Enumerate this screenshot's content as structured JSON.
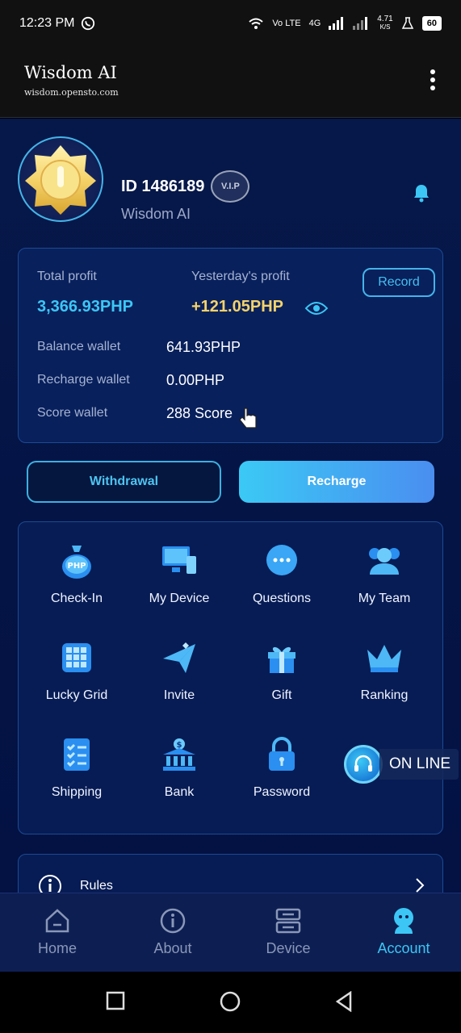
{
  "status_bar": {
    "time": "12:23 PM",
    "network": "4G",
    "speed": "4.71",
    "speed_unit": "K/S",
    "battery": "60",
    "volte": "Vo LTE"
  },
  "header": {
    "title": "Wisdom AI",
    "url": "wisdom.opensto.com"
  },
  "profile": {
    "id_label": "ID 1486189",
    "vip": "V.I.P",
    "name": "Wisdom AI"
  },
  "wallet": {
    "total_profit_label": "Total profit",
    "total_profit_value": "3,366.93PHP",
    "yesterday_label": "Yesterday's profit",
    "yesterday_value": "+121.05PHP",
    "record_label": "Record",
    "rows": [
      {
        "label": "Balance wallet",
        "value": "641.93PHP"
      },
      {
        "label": "Recharge wallet",
        "value": "0.00PHP"
      },
      {
        "label": "Score wallet",
        "value": "288 Score"
      }
    ]
  },
  "actions": {
    "withdraw": "Withdrawal",
    "recharge": "Recharge"
  },
  "grid": [
    {
      "label": "Check-In",
      "icon": "php-bag-icon"
    },
    {
      "label": "My Device",
      "icon": "device-icon"
    },
    {
      "label": "Questions",
      "icon": "chat-bubble-icon"
    },
    {
      "label": "My Team",
      "icon": "team-icon"
    },
    {
      "label": "Lucky Grid",
      "icon": "grid-icon"
    },
    {
      "label": "Invite",
      "icon": "paper-plane-icon"
    },
    {
      "label": "Gift",
      "icon": "gift-icon"
    },
    {
      "label": "Ranking",
      "icon": "crown-icon"
    },
    {
      "label": "Shipping",
      "icon": "checklist-icon"
    },
    {
      "label": "Bank",
      "icon": "bank-icon"
    },
    {
      "label": "Password",
      "icon": "lock-icon"
    }
  ],
  "online": "ON LINE",
  "rules": "Rules",
  "bottom_nav": [
    {
      "label": "Home",
      "icon": "home-icon"
    },
    {
      "label": "About",
      "icon": "info-icon"
    },
    {
      "label": "Device",
      "icon": "device-stack-icon"
    },
    {
      "label": "Account",
      "icon": "account-icon",
      "active": true
    }
  ],
  "colors": {
    "accent": "#3cc6f5",
    "gold": "#f5d36a",
    "background": "#06184a"
  }
}
